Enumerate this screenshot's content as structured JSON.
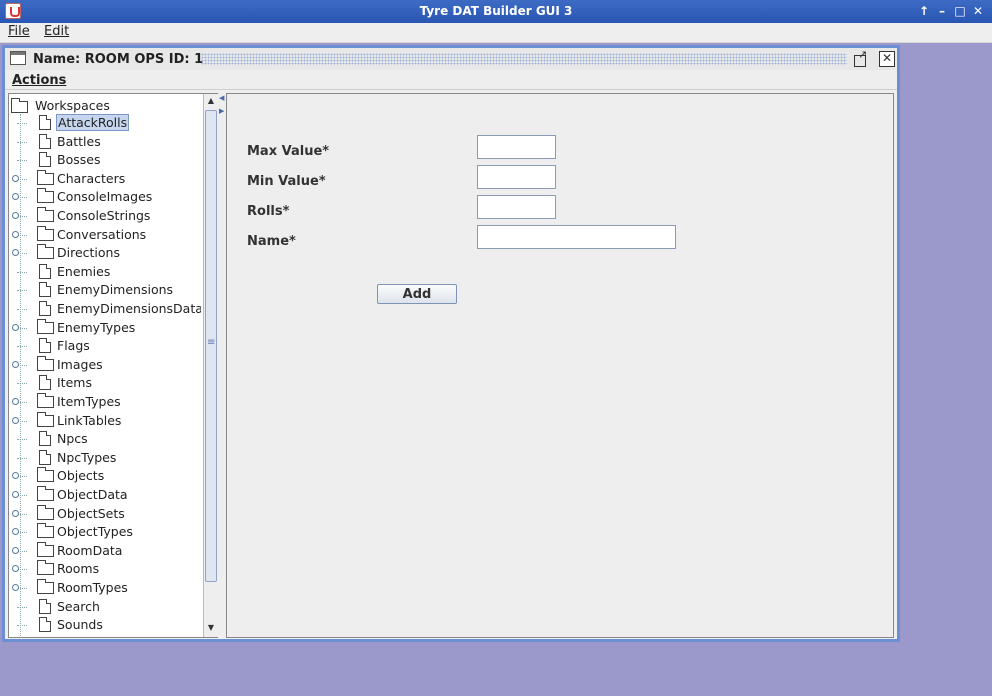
{
  "window": {
    "title": "Tyre DAT Builder GUI 3",
    "controls": [
      "↑",
      "–",
      "□",
      "✕"
    ]
  },
  "menubar": {
    "file": "File",
    "edit": "Edit"
  },
  "frame": {
    "title": "Name: ROOM OPS ID: 1",
    "actions_menu": "Actions"
  },
  "tree": {
    "root": "Workspaces",
    "items": [
      {
        "label": "AttackRolls",
        "kind": "file",
        "selected": true
      },
      {
        "label": "Battles",
        "kind": "file"
      },
      {
        "label": "Bosses",
        "kind": "file"
      },
      {
        "label": "Characters",
        "kind": "folder"
      },
      {
        "label": "ConsoleImages",
        "kind": "folder"
      },
      {
        "label": "ConsoleStrings",
        "kind": "folder"
      },
      {
        "label": "Conversations",
        "kind": "folder"
      },
      {
        "label": "Directions",
        "kind": "folder"
      },
      {
        "label": "Enemies",
        "kind": "file"
      },
      {
        "label": "EnemyDimensions",
        "kind": "file"
      },
      {
        "label": "EnemyDimensionsData",
        "kind": "file"
      },
      {
        "label": "EnemyTypes",
        "kind": "folder"
      },
      {
        "label": "Flags",
        "kind": "file"
      },
      {
        "label": "Images",
        "kind": "folder"
      },
      {
        "label": "Items",
        "kind": "file"
      },
      {
        "label": "ItemTypes",
        "kind": "folder"
      },
      {
        "label": "LinkTables",
        "kind": "folder"
      },
      {
        "label": "Npcs",
        "kind": "file"
      },
      {
        "label": "NpcTypes",
        "kind": "file"
      },
      {
        "label": "Objects",
        "kind": "folder"
      },
      {
        "label": "ObjectData",
        "kind": "folder"
      },
      {
        "label": "ObjectSets",
        "kind": "folder"
      },
      {
        "label": "ObjectTypes",
        "kind": "folder"
      },
      {
        "label": "RoomData",
        "kind": "folder"
      },
      {
        "label": "Rooms",
        "kind": "folder"
      },
      {
        "label": "RoomTypes",
        "kind": "folder"
      },
      {
        "label": "Search",
        "kind": "file"
      },
      {
        "label": "Sounds",
        "kind": "file"
      }
    ]
  },
  "form": {
    "max_value_label": "Max Value*",
    "min_value_label": "Min Value*",
    "rolls_label": "Rolls*",
    "name_label": "Name*",
    "max_value": "",
    "min_value": "",
    "rolls": "",
    "name": "",
    "add_button": "Add"
  }
}
